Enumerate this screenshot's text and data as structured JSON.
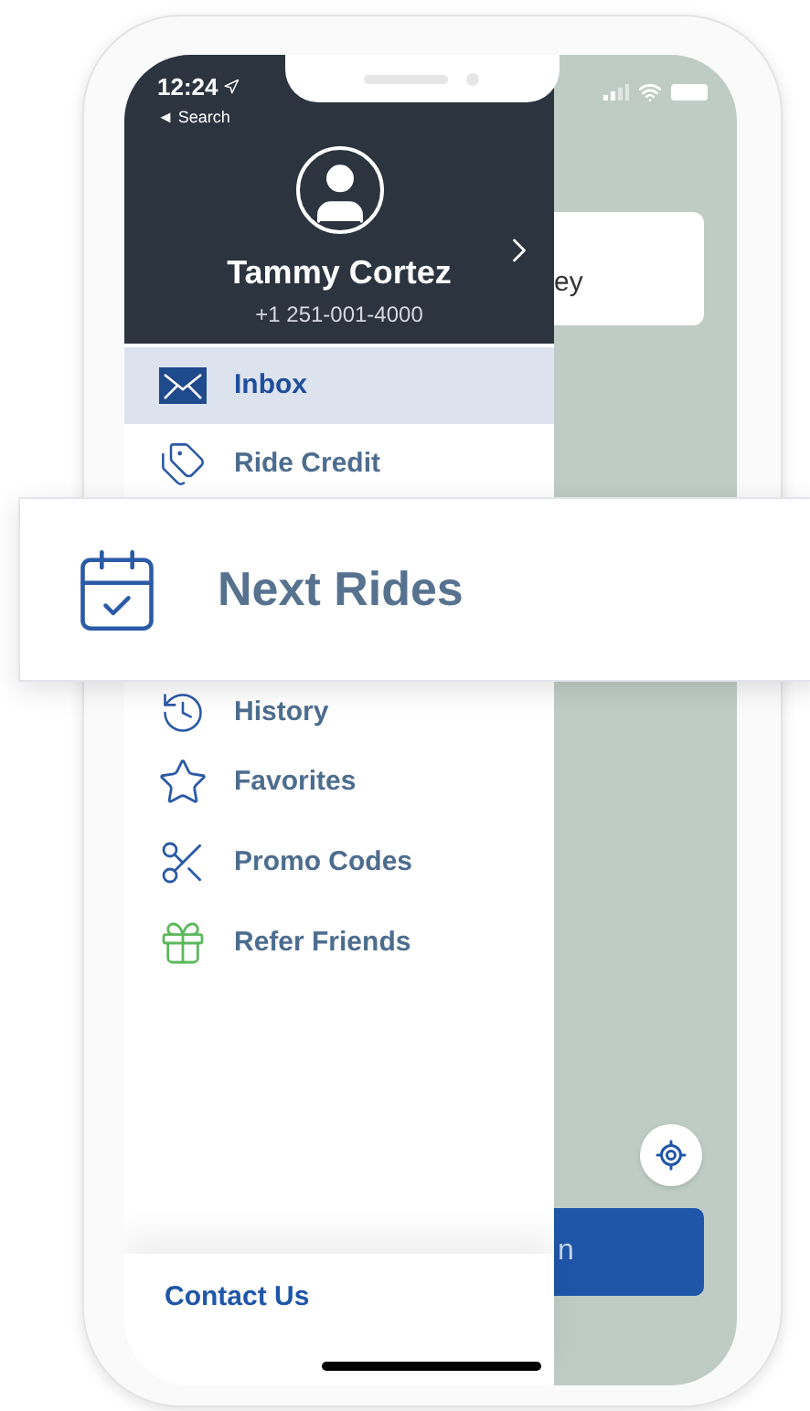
{
  "status_bar": {
    "time": "12:24",
    "back_label": "◄ Search"
  },
  "profile": {
    "name": "Tammy Cortez",
    "phone": "+1 251-001-4000"
  },
  "menu_top": [
    {
      "label": "Inbox",
      "selected": true
    },
    {
      "label": "Ride Credit",
      "selected": false
    }
  ],
  "menu_bottom": [
    {
      "label": "History",
      "selected": false
    },
    {
      "label": "Favorites",
      "selected": false
    },
    {
      "label": "Promo Codes",
      "selected": false
    },
    {
      "label": "Refer Friends",
      "selected": false
    }
  ],
  "footer": {
    "link": "Contact Us"
  },
  "map": {
    "search_card_text": "ey",
    "action_button_text": "n"
  },
  "highlight": {
    "label": "Next Rides"
  }
}
